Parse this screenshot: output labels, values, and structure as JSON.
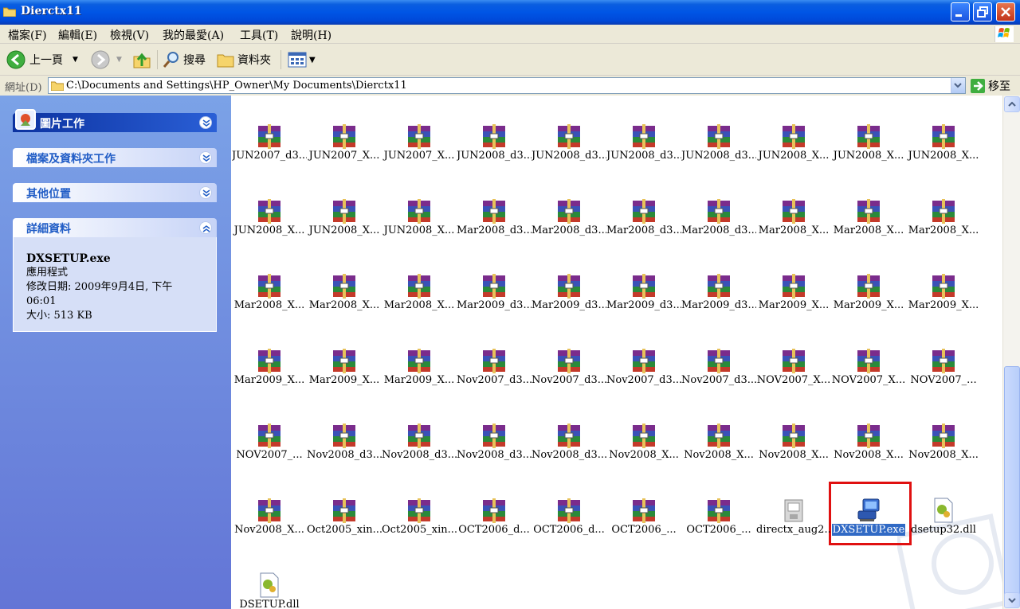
{
  "window": {
    "title": "Dierctx11"
  },
  "menubar": [
    "檔案(F)",
    "編輯(E)",
    "檢視(V)",
    "我的最愛(A)",
    "工具(T)",
    "說明(H)"
  ],
  "toolbar": {
    "back_label": "上一頁",
    "search_label": "搜尋",
    "folders_label": "資料夾"
  },
  "address": {
    "label": "網址(D)",
    "path": "C:\\Documents and Settings\\HP_Owner\\My Documents\\Dierctx11",
    "go_label": "移至"
  },
  "leftpane": {
    "picture_tasks": "圖片工作",
    "file_folder_tasks": "檔案及資料夾工作",
    "other_places": "其他位置",
    "details": "詳細資料",
    "detail_name": "DXSETUP.exe",
    "detail_type": "應用程式",
    "detail_modified_1": "修改日期: 2009年9月4日, 下午",
    "detail_modified_2": "06:01",
    "detail_size": "大小: 513 KB"
  },
  "files": [
    {
      "name": "JUN2007_d3...",
      "icon": "rar-archive-icon"
    },
    {
      "name": "JUN2007_X...",
      "icon": "rar-archive-icon"
    },
    {
      "name": "JUN2007_X...",
      "icon": "rar-archive-icon"
    },
    {
      "name": "JUN2008_d3...",
      "icon": "rar-archive-icon"
    },
    {
      "name": "JUN2008_d3...",
      "icon": "rar-archive-icon"
    },
    {
      "name": "JUN2008_d3...",
      "icon": "rar-archive-icon"
    },
    {
      "name": "JUN2008_d3...",
      "icon": "rar-archive-icon"
    },
    {
      "name": "JUN2008_X...",
      "icon": "rar-archive-icon"
    },
    {
      "name": "JUN2008_X...",
      "icon": "rar-archive-icon"
    },
    {
      "name": "JUN2008_X...",
      "icon": "rar-archive-icon"
    },
    {
      "name": "JUN2008_X...",
      "icon": "rar-archive-icon"
    },
    {
      "name": "JUN2008_X...",
      "icon": "rar-archive-icon"
    },
    {
      "name": "JUN2008_X...",
      "icon": "rar-archive-icon"
    },
    {
      "name": "Mar2008_d3...",
      "icon": "rar-archive-icon"
    },
    {
      "name": "Mar2008_d3...",
      "icon": "rar-archive-icon"
    },
    {
      "name": "Mar2008_d3...",
      "icon": "rar-archive-icon"
    },
    {
      "name": "Mar2008_d3...",
      "icon": "rar-archive-icon"
    },
    {
      "name": "Mar2008_X...",
      "icon": "rar-archive-icon"
    },
    {
      "name": "Mar2008_X...",
      "icon": "rar-archive-icon"
    },
    {
      "name": "Mar2008_X...",
      "icon": "rar-archive-icon"
    },
    {
      "name": "Mar2008_X...",
      "icon": "rar-archive-icon"
    },
    {
      "name": "Mar2008_X...",
      "icon": "rar-archive-icon"
    },
    {
      "name": "Mar2008_X...",
      "icon": "rar-archive-icon"
    },
    {
      "name": "Mar2009_d3...",
      "icon": "rar-archive-icon"
    },
    {
      "name": "Mar2009_d3...",
      "icon": "rar-archive-icon"
    },
    {
      "name": "Mar2009_d3...",
      "icon": "rar-archive-icon"
    },
    {
      "name": "Mar2009_d3...",
      "icon": "rar-archive-icon"
    },
    {
      "name": "Mar2009_X...",
      "icon": "rar-archive-icon"
    },
    {
      "name": "Mar2009_X...",
      "icon": "rar-archive-icon"
    },
    {
      "name": "Mar2009_X...",
      "icon": "rar-archive-icon"
    },
    {
      "name": "Mar2009_X...",
      "icon": "rar-archive-icon"
    },
    {
      "name": "Mar2009_X...",
      "icon": "rar-archive-icon"
    },
    {
      "name": "Mar2009_X...",
      "icon": "rar-archive-icon"
    },
    {
      "name": "Nov2007_d3...",
      "icon": "rar-archive-icon"
    },
    {
      "name": "Nov2007_d3...",
      "icon": "rar-archive-icon"
    },
    {
      "name": "Nov2007_d3...",
      "icon": "rar-archive-icon"
    },
    {
      "name": "Nov2007_d3...",
      "icon": "rar-archive-icon"
    },
    {
      "name": "NOV2007_X...",
      "icon": "rar-archive-icon"
    },
    {
      "name": "NOV2007_X...",
      "icon": "rar-archive-icon"
    },
    {
      "name": "NOV2007_...",
      "icon": "rar-archive-icon"
    },
    {
      "name": "NOV2007_...",
      "icon": "rar-archive-icon"
    },
    {
      "name": "Nov2008_d3...",
      "icon": "rar-archive-icon"
    },
    {
      "name": "Nov2008_d3...",
      "icon": "rar-archive-icon"
    },
    {
      "name": "Nov2008_d3...",
      "icon": "rar-archive-icon"
    },
    {
      "name": "Nov2008_d3...",
      "icon": "rar-archive-icon"
    },
    {
      "name": "Nov2008_X...",
      "icon": "rar-archive-icon"
    },
    {
      "name": "Nov2008_X...",
      "icon": "rar-archive-icon"
    },
    {
      "name": "Nov2008_X...",
      "icon": "rar-archive-icon"
    },
    {
      "name": "Nov2008_X...",
      "icon": "rar-archive-icon"
    },
    {
      "name": "Nov2008_X...",
      "icon": "rar-archive-icon"
    },
    {
      "name": "Nov2008_X...",
      "icon": "rar-archive-icon"
    },
    {
      "name": "Oct2005_xin...",
      "icon": "rar-archive-icon"
    },
    {
      "name": "Oct2005_xin...",
      "icon": "rar-archive-icon"
    },
    {
      "name": "OCT2006_d...",
      "icon": "rar-archive-icon"
    },
    {
      "name": "OCT2006_d...",
      "icon": "rar-archive-icon"
    },
    {
      "name": "OCT2006_...",
      "icon": "rar-archive-icon"
    },
    {
      "name": "OCT2006_...",
      "icon": "rar-archive-icon"
    },
    {
      "name": "directx_aug2...",
      "icon": "installer-package-icon"
    },
    {
      "name": "DXSETUP.exe",
      "icon": "setup-computer-icon",
      "selected": true
    },
    {
      "name": "dsetup32.dll",
      "icon": "dll-file-icon"
    },
    {
      "name": "DSETUP.dll",
      "icon": "dll-file-icon"
    }
  ]
}
